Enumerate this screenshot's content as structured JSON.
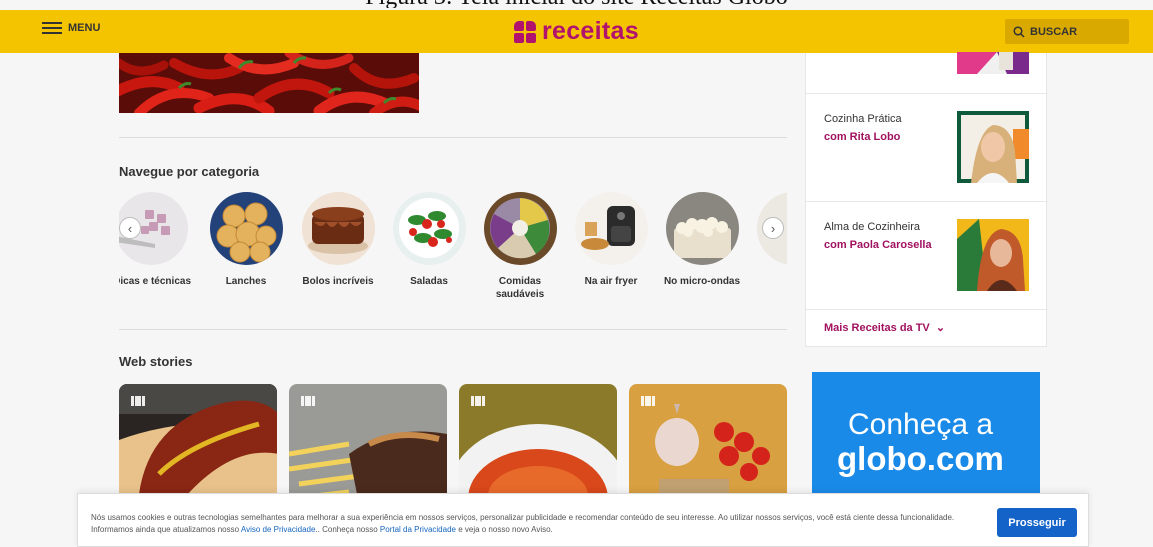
{
  "caption": "Figura 3: Tela inicial do site Receitas Globo",
  "header": {
    "menu_label": "MENU",
    "logo_text": "receitas",
    "search_label": "BUSCAR",
    "brand_color": "#f5c400",
    "logo_color": "#b0126e"
  },
  "categories": {
    "title": "Navegue por categoria",
    "items": [
      {
        "label": "Dicas e técnicas"
      },
      {
        "label": "Lanches"
      },
      {
        "label": "Bolos incríveis"
      },
      {
        "label": "Saladas"
      },
      {
        "label": "Comidas saudáveis"
      },
      {
        "label": "Na air fryer"
      },
      {
        "label": "No micro-ondas"
      }
    ]
  },
  "web_stories": {
    "title": "Web stories"
  },
  "sidebar": {
    "shows": [
      {
        "title": "Cozinha Prática",
        "host": "com Rita Lobo"
      },
      {
        "title": "Alma de Cozinheira",
        "host": "com Paola Carosella"
      }
    ],
    "more_label": "Mais Receitas da TV"
  },
  "ad": {
    "line1": "Conheça a",
    "line2": "globo.com"
  },
  "cookie": {
    "text_1": "Nós usamos cookies e outras tecnologias semelhantes para melhorar a sua experiência em nossos serviços, personalizar publicidade e recomendar conteúdo de seu interesse. Ao utilizar nossos serviços, você está ciente dessa funcionalidade. Informamos ainda que atualizamos nosso ",
    "link_1": "Aviso de Privacidade",
    "text_2": ".. Conheça nosso ",
    "link_2": "Portal da Privacidade",
    "text_3": " e veja o nosso novo Aviso.",
    "button_label": "Prosseguir"
  }
}
